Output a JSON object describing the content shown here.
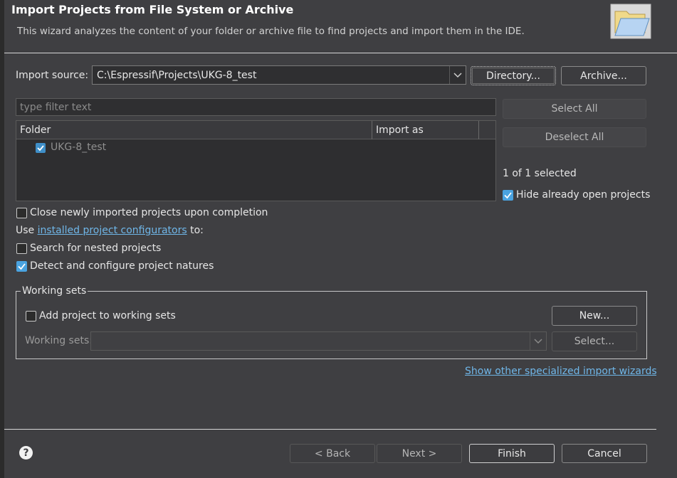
{
  "header": {
    "title": "Import Projects from File System or Archive",
    "subtitle": "This wizard analyzes the content of your folder or archive file to find projects and import them in the IDE.",
    "icon": "folder-icon"
  },
  "source": {
    "label": "Import source:",
    "value": "C:\\Espressif\\Projects\\UKG-8_test",
    "directory_button": "Directory...",
    "archive_button": "Archive..."
  },
  "filter": {
    "placeholder": "type filter text"
  },
  "table": {
    "columns": [
      "Folder",
      "Import as"
    ],
    "rows": [
      {
        "folder": "UKG-8_test",
        "import_as": "",
        "checked": true
      }
    ]
  },
  "side": {
    "select_all": "Select All",
    "deselect_all": "Deselect All",
    "selection_status": "1 of 1 selected",
    "hide_open_label": "Hide already open projects",
    "hide_open_checked": true
  },
  "options": {
    "close_imported": {
      "label": "Close newly imported projects upon completion",
      "checked": false
    },
    "use_prefix": "Use ",
    "configurators_link": "installed project configurators",
    "use_suffix": " to:",
    "search_nested": {
      "label": "Search for nested projects",
      "checked": false
    },
    "detect_natures": {
      "label": "Detect and configure project natures",
      "checked": true
    }
  },
  "working_sets": {
    "group_label": "Working sets",
    "add_label": "Add project to working sets",
    "add_checked": false,
    "new_button": "New...",
    "combo_label": "Working sets:",
    "combo_value": "",
    "select_button": "Select..."
  },
  "other_wizards_link": "Show other specialized import wizards",
  "footer": {
    "help_icon": "help-icon",
    "back": "< Back",
    "next": "Next >",
    "finish": "Finish",
    "cancel": "Cancel"
  },
  "colors": {
    "accent": "#4aa3e0",
    "link": "#6fb6e8",
    "background": "#3f3f42"
  }
}
